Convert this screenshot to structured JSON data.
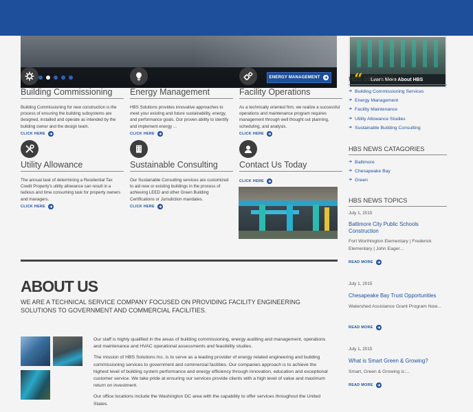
{
  "slider": {
    "button_label": "ENERGY MANAGEMENT",
    "dots_total": 6,
    "active_dot": 3
  },
  "promo": {
    "label": "Learn More About HBS"
  },
  "services": [
    {
      "title": "Building Commissioning",
      "icon": "gear-tools-icon",
      "desc": "Building Commissioning for new construction is the process of ensuring the building subsystems are designed, installed and operate as intended by the building owner and the design team.",
      "link": "CLICK HERE"
    },
    {
      "title": "Energy Management",
      "icon": "lightbulb-icon",
      "desc": "HBS Solutions provides innovative approaches to meet your existing and future sustainability, energy, and performance goals. Our proven ability to identify and implement energy ...",
      "link": "CLICK HERE"
    },
    {
      "title": "Facility Operations",
      "icon": "cogs-icon",
      "desc": "As a technically oriented firm, we realize a successful operations and maintenance program requires management through well thought out planning, scheduling, and analysis.",
      "link": "CLICK HERE"
    },
    {
      "title": "Utility Allowance",
      "icon": "wrench-screwdriver-icon",
      "desc": "The annual task of determining a Residential Tax Credit Property's utility allowance can result in a tedious and time consuming task for property owners and managers.",
      "link": "CLICK HERE"
    },
    {
      "title": "Sustainable Consulting",
      "icon": "building-icon",
      "desc": "Our Sustainable Consulting services are customized to aid new or existing buildings in the process of achieving LEED and other Green Building Certifications or Jurisdiction mandates.",
      "link": "CLICK HERE"
    },
    {
      "title": "Contact Us Today",
      "icon": "user-icon",
      "desc": "",
      "link": "CLICK HERE"
    }
  ],
  "about": {
    "title": "ABOUT US",
    "subtitle": "WE ARE A TECHNICAL SERVICE COMPANY FOCUSED ON PROVIDING FACILITY ENGINEERING SOLUTIONS TO GOVERNMENT AND COMMERCIAL FACILITIES.",
    "p1": "Our staff is highly qualified in the areas of building commissioning, energy auditing and management, operations and maintenance and HVAC operational assessments and feasibility studies.",
    "p2": "The mission of HBS Solutions Inc. is to serve as a leading provider of energy related engineering and building commissioning services to government and commercial facilities. Our companies approach is to achieve the highest level of building system performance and energy efficiency through innovation, education and exceptional customer service. We take pride at ensuring our services provide clients with a high level of value and maximum return on investment.",
    "p3": "Our office locations include the Washington DC area with the capability to offer services throughout the United States."
  },
  "sidebar": {
    "services_heading": "HBS SERVICES",
    "services": [
      "Building Commissioning Services",
      "Energy Management",
      "Facility Maintenance",
      "Utility Allowance Studies",
      "Sustainable Building Consulting"
    ],
    "categories_heading": "HBS NEWS CATAGORIES",
    "categories": [
      "Baltimore",
      "Chesapeake Bay",
      "Green"
    ],
    "topics_heading": "HBS NEWS TOPICS",
    "news": [
      {
        "date": "July 1, 2015",
        "title": "Baltimore City Public Schools Construction",
        "excerpt": "Fort Worthington Elementary | Frederick Elementary | John Eager...",
        "more": "READ MORE"
      },
      {
        "date": "July 1, 2015",
        "title": "Chesapeake Bay Trust Opportunities",
        "excerpt": "Watershed Assistance Grant Program Now...",
        "more": "READ MORE"
      },
      {
        "date": "July 1, 2015",
        "title": "What is Smart Green & Growing?",
        "excerpt": "Smart, Green & Growing is:...",
        "more": "READ MORE"
      }
    ]
  },
  "colors": {
    "brand_blue": "#1d4f9a",
    "link_blue": "#1d4f9a",
    "dark_text": "#3a3a3a",
    "promo_quote": "#f2c200"
  }
}
